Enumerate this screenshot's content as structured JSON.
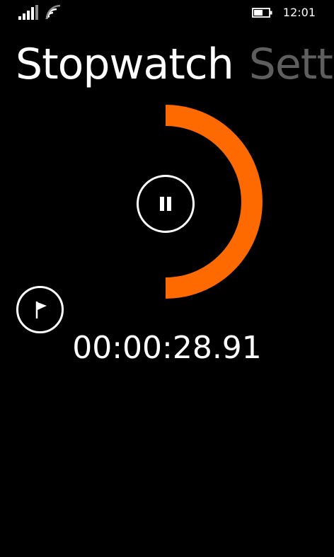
{
  "status_bar": {
    "signal_icon": "signal-strength-icon",
    "wifi_icon": "wifi-icon",
    "battery_icon": "battery-icon",
    "battery_level": 0.6,
    "time": "12:01"
  },
  "pivot": {
    "items": [
      {
        "label": "Stopwatch",
        "active": true
      },
      {
        "label": "Settin",
        "active": false
      }
    ]
  },
  "timer": {
    "progress": 0.5,
    "progress_color": "#ff6a00",
    "pause_icon": "pause-icon",
    "lap_icon": "flag-icon",
    "elapsed": "00:00:28.91"
  }
}
